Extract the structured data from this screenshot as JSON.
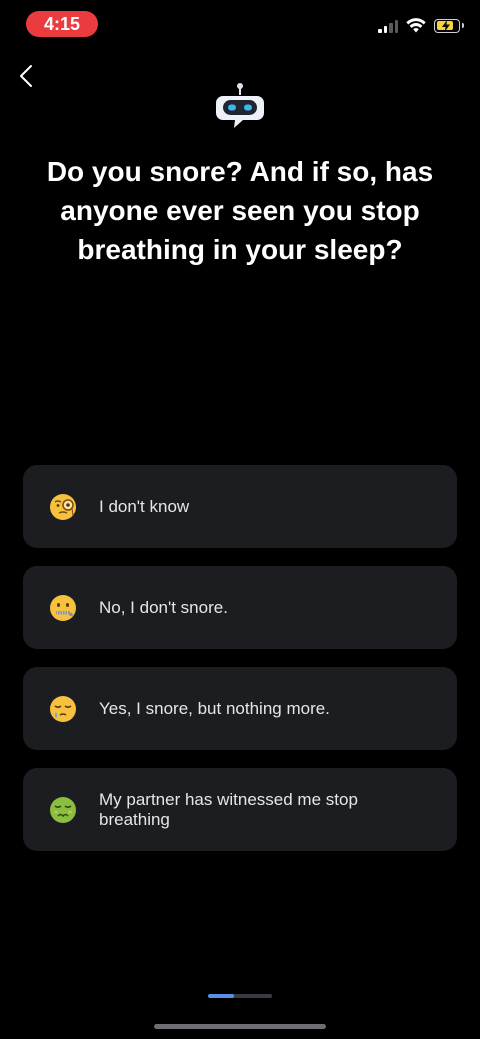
{
  "status_bar": {
    "time": "4:15",
    "time_pill_color": "#ea3b3f",
    "battery_color": "#f5d33a",
    "icons": [
      "cellular-signal-icon",
      "wifi-icon",
      "battery-charging-icon"
    ]
  },
  "nav": {
    "back_icon": "chevron-left-icon"
  },
  "bot": {
    "icon": "robot-chat-icon"
  },
  "question": "Do you snore? And if so, has anyone ever seen you stop breathing in your sleep?",
  "options": [
    {
      "icon": "monocle-face-emoji",
      "label": "I don't know"
    },
    {
      "icon": "zipper-mouth-face-emoji",
      "label": "No, I don't snore."
    },
    {
      "icon": "sleepy-face-emoji",
      "label": "Yes, I snore, but nothing more."
    },
    {
      "icon": "nauseated-face-emoji",
      "label": "My partner has witnessed me stop breathing"
    }
  ],
  "progress": {
    "fraction": 0.4,
    "accent_color": "#5b8fe6"
  }
}
